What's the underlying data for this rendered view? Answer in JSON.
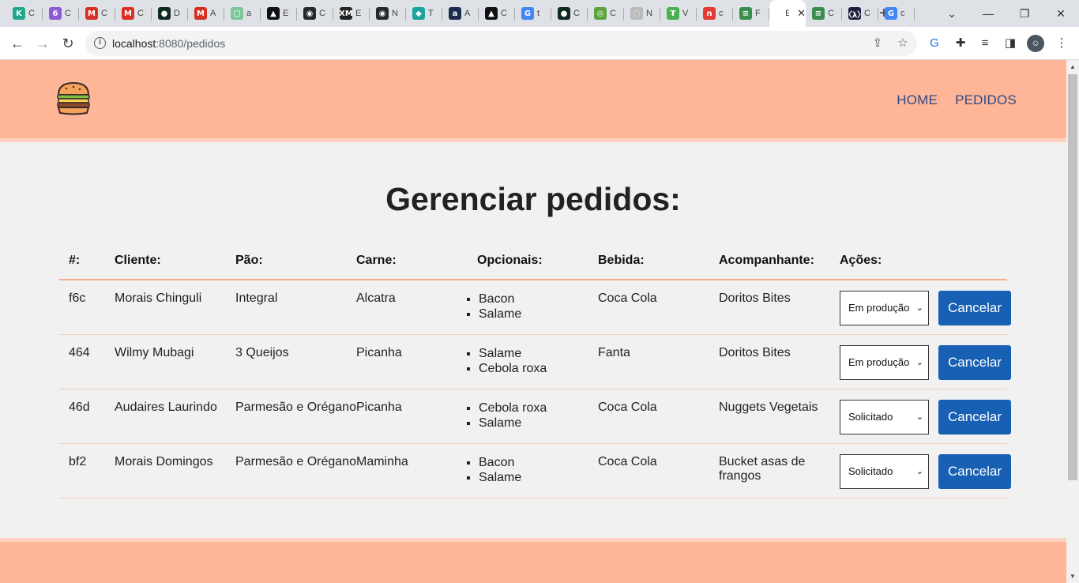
{
  "browser": {
    "tabs": [
      {
        "letter": "K",
        "title": "C",
        "color": "#23a78c"
      },
      {
        "letter": "6",
        "title": "C",
        "color": "#8e5bd6"
      },
      {
        "letter": "M",
        "title": "C",
        "color": "#d93025"
      },
      {
        "letter": "M",
        "title": "C",
        "color": "#d93025"
      },
      {
        "letter": "●",
        "title": "D",
        "color": "#0f2a1f"
      },
      {
        "letter": "M",
        "title": "A",
        "color": "#d93025"
      },
      {
        "letter": "▢",
        "title": "a",
        "color": "#7cc79a"
      },
      {
        "letter": "▲",
        "title": "E",
        "color": "#111111"
      },
      {
        "letter": "◉",
        "title": "C",
        "color": "#24292f"
      },
      {
        "letter": "XM",
        "title": "E",
        "color": "#222222"
      },
      {
        "letter": "◉",
        "title": "N",
        "color": "#24292f"
      },
      {
        "letter": "◆",
        "title": "T",
        "color": "#1ba39c"
      },
      {
        "letter": "a",
        "title": "A",
        "color": "#1a2b4c"
      },
      {
        "letter": "▲",
        "title": "C",
        "color": "#111111"
      },
      {
        "letter": "G",
        "title": "t",
        "color": "#4285f4"
      },
      {
        "letter": "●",
        "title": "C",
        "color": "#0f2a1f"
      },
      {
        "letter": "◎",
        "title": "C",
        "color": "#5ba33b"
      },
      {
        "letter": "◌",
        "title": "N",
        "color": "#bbbbbb"
      },
      {
        "letter": "₮",
        "title": "V",
        "color": "#4caf50"
      },
      {
        "letter": "n",
        "title": "c",
        "color": "#e53935"
      },
      {
        "letter": "≡",
        "title": "F",
        "color": "#3b8d4e"
      },
      {
        "letter": "",
        "title": "E",
        "color": "#ffffff",
        "active": true
      },
      {
        "letter": "≡",
        "title": "C",
        "color": "#3b8d4e"
      },
      {
        "letter": "〈λ〉",
        "title": "C",
        "color": "#1b1f3b"
      },
      {
        "letter": "G",
        "title": "c",
        "color": "#4285f4"
      }
    ],
    "url_host": "localhost",
    "url_path": ":8080/pedidos"
  },
  "nav": {
    "home": "HOME",
    "pedidos": "PEDIDOS"
  },
  "page_title": "Gerenciar pedidos:",
  "table": {
    "headers": [
      "#:",
      "Cliente:",
      "Pão:",
      "Carne:",
      "Opcionais:",
      "Bebida:",
      "Acompanhante:",
      "Ações:"
    ],
    "rows": [
      {
        "id": "f6c",
        "cliente": "Morais Chinguli",
        "pao": "Integral",
        "carne": "Alcatra",
        "opcionais": [
          "Bacon",
          "Salame"
        ],
        "bebida": "Coca Cola",
        "acompanhante": "Doritos Bites",
        "status": "Em produção",
        "cancel": "Cancelar"
      },
      {
        "id": "464",
        "cliente": "Wilmy Mubagi",
        "pao": "3 Queijos",
        "carne": "Picanha",
        "opcionais": [
          "Salame",
          "Cebola roxa"
        ],
        "bebida": "Fanta",
        "acompanhante": "Doritos Bites",
        "status": "Em produção",
        "cancel": "Cancelar"
      },
      {
        "id": "46d",
        "cliente": "Audaires Laurindo",
        "pao": "Parmesão e Orégano",
        "carne": "Picanha",
        "opcionais": [
          "Cebola roxa",
          "Salame"
        ],
        "bebida": "Coca Cola",
        "acompanhante": "Nuggets Vegetais",
        "status": "Solicitado",
        "cancel": "Cancelar"
      },
      {
        "id": "bf2",
        "cliente": "Morais Domingos",
        "pao": "Parmesão e Orégano",
        "carne": "Maminha",
        "opcionais": [
          "Bacon",
          "Salame"
        ],
        "bebida": "Coca Cola",
        "acompanhante": "Bucket asas de frangos",
        "status": "Solicitado",
        "cancel": "Cancelar"
      }
    ]
  }
}
